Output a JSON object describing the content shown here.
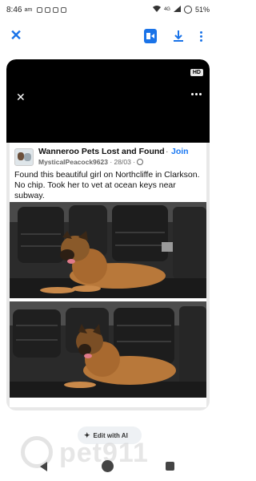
{
  "status_bar": {
    "time": "8:46",
    "ampm": "am",
    "network": "4G",
    "battery": "51%"
  },
  "toolbar": {
    "icons": [
      "close-icon",
      "open-in-app-icon",
      "download-icon",
      "more-vertical-icon"
    ],
    "accent_color": "#1a73e8"
  },
  "video": {
    "hd_label": "HD"
  },
  "post": {
    "group_name": "Wanneroo Pets Lost and Found",
    "separator": "·",
    "join_label": "Join",
    "author": "MysticalPeacock9623",
    "date": "28/03",
    "text": "Found this beautiful girl on Northcliffe in Clarkson. No chip. Took her to vet at ocean keys near subway."
  },
  "edit_ai": {
    "label": "Edit with AI"
  },
  "watermark": {
    "text": "pet911"
  },
  "nav": {
    "icons": [
      "back-icon",
      "home-icon",
      "recents-icon"
    ]
  }
}
